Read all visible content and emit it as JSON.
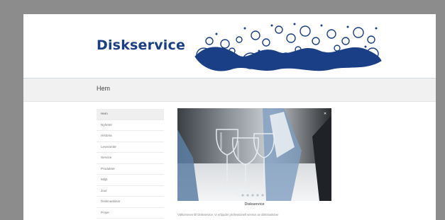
{
  "site": {
    "logo_text": "Diskservice"
  },
  "breadcrumb": {
    "title": "Hem"
  },
  "sidebar": {
    "items": [
      {
        "label": "Hem"
      },
      {
        "label": "Nyheter"
      },
      {
        "label": "Historia"
      },
      {
        "label": "Leverantör"
      },
      {
        "label": "Service"
      },
      {
        "label": "Produkter"
      },
      {
        "label": "Miljö"
      },
      {
        "label": "Jour"
      },
      {
        "label": "Diskmaskiner"
      },
      {
        "label": "Priser"
      }
    ]
  },
  "slideshow": {
    "caption": "Diskservice",
    "dot_count": 5,
    "active_dot": 0
  },
  "content": {
    "intro": "Välkommen till Diskservice. Vi erbjuder professionell service av diskmaskiner"
  },
  "colors": {
    "brand": "#1b3f86",
    "background": "#8c8c8c"
  }
}
